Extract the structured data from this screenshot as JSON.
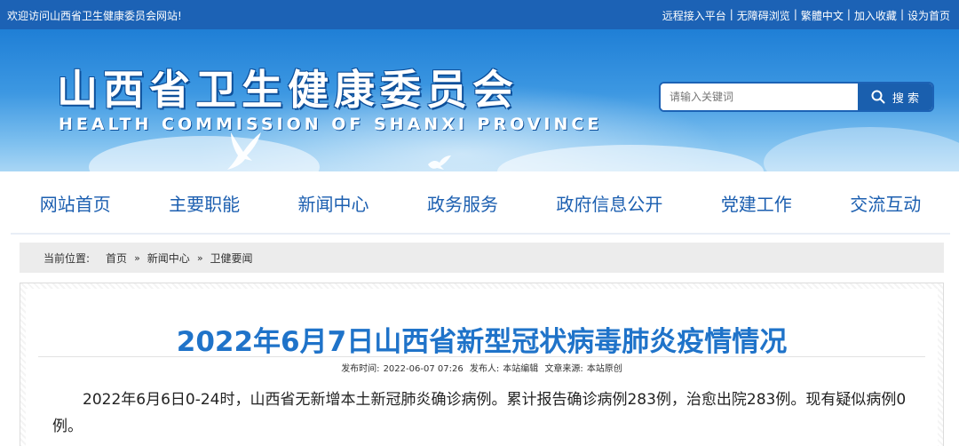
{
  "topbar": {
    "welcome": "欢迎访问山西省卫生健康委员会网站!",
    "links": [
      "远程接入平台",
      "无障碍浏览",
      "繁體中文",
      "加入收藏",
      "设为首页"
    ],
    "separator": "|"
  },
  "header": {
    "title_cn": "山西省卫生健康委员会",
    "title_en": "HEALTH COMMISSION OF SHANXI PROVINCE"
  },
  "search": {
    "placeholder": "请输入关键词",
    "button_label": "搜 索",
    "icon": "search-icon"
  },
  "nav": {
    "items": [
      "网站首页",
      "主要职能",
      "新闻中心",
      "政务服务",
      "政府信息公开",
      "党建工作",
      "交流互动"
    ]
  },
  "breadcrumb": {
    "label": "当前位置:",
    "items": [
      "首页",
      "新闻中心",
      "卫健要闻"
    ],
    "arrow": "»"
  },
  "article": {
    "title": "2022年6月7日山西省新型冠状病毒肺炎疫情情况",
    "meta": {
      "time_label": "发布时间:",
      "time": "2022-06-07 07:26",
      "publisher_label": "发布人:",
      "publisher": "本站编辑",
      "source_label": "文章来源:",
      "source": "本站原创"
    },
    "body": "2022年6月6日0-24时，山西省无新增本土新冠肺炎确诊病例。累计报告确诊病例283例，治愈出院283例。现有疑似病例0例。"
  },
  "colors": {
    "primary": "#1c62b5",
    "nav_text": "#1c5fb0",
    "title": "#1f73c9"
  }
}
